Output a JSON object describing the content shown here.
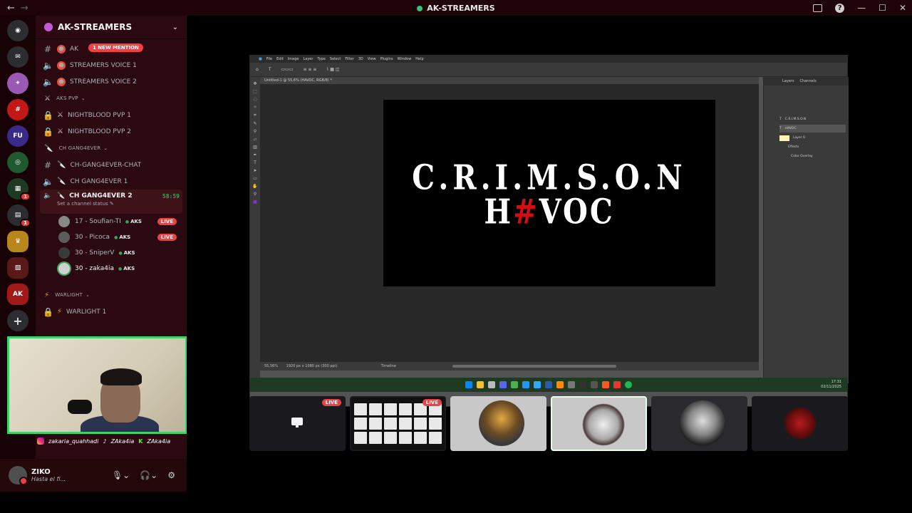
{
  "window": {
    "title": "AK-STREAMERS"
  },
  "server": {
    "name": "AK-STREAMERS",
    "mention_badge": "1 NEW MENTION",
    "rail_badges": [
      "1",
      "1"
    ]
  },
  "channels": {
    "top": [
      {
        "name": "AK",
        "icon": "#"
      },
      {
        "name": "STREAMERS VOICE 1",
        "icon": "voice"
      },
      {
        "name": "STREAMERS VOICE 2",
        "icon": "voice"
      }
    ],
    "cat_aks_pvp": "AKS PVP",
    "aks_pvp": [
      {
        "name": "NIGHTBLOOD PVP 1"
      },
      {
        "name": "NIGHTBLOOD PVP 2"
      }
    ],
    "cat_gang": "CH GANG4EVER",
    "gang": [
      {
        "name": "CH-GANG4EVER-CHAT"
      },
      {
        "name": "CH GANG4EVER 1"
      }
    ],
    "active": {
      "name": "CH GANG4EVER 2",
      "timer": "58:59",
      "status": "Set a channel status"
    },
    "voice_users": [
      {
        "name": "17 - Soufian-TI",
        "tag": "AKS",
        "live": "LIVE"
      },
      {
        "name": "30 - Picoca",
        "tag": "AKS",
        "live": "LIVE"
      },
      {
        "name": "30 - SniperV",
        "tag": "AKS"
      },
      {
        "name": "30 - zaka4ia",
        "tag": "AKS"
      }
    ],
    "cat_warlight": "WARLIGHT",
    "warlight": [
      {
        "name": "WARLIGHT 1"
      }
    ]
  },
  "webcam": {
    "social_ig": "zakaria_quahhadi",
    "social_tt": "ZAka4ia",
    "social_kick": "ZAka4ia"
  },
  "user": {
    "name": "ZIKO",
    "status": "Hasta el fi..."
  },
  "photoshop": {
    "menu": [
      "File",
      "Edit",
      "Image",
      "Layer",
      "Type",
      "Select",
      "Filter",
      "3D",
      "View",
      "Plugins",
      "Window",
      "Help"
    ],
    "doc_tab": "Untitled-1 @ 55,6% (HAVOC, RGB/8) *",
    "zoom": "55,56%",
    "doc_info": "1920 px x 1080 px (300 ppi)",
    "timeline": "Timeline",
    "panel_tabs": [
      "Layers",
      "Channels"
    ],
    "layers": [
      "C.R.I.M.S.O.N",
      "HAVOC",
      "Layer 0",
      "Effects",
      "Color Overlay"
    ],
    "logo_line1": "C.R.I.M.S.O.N",
    "logo_line2_a": "H",
    "logo_line2_hash": "#",
    "logo_line2_b": "VOC",
    "clock_time": "17:31",
    "clock_date": "02/11/2025"
  },
  "tiles": [
    {
      "kind": "screen",
      "live": "LIVE"
    },
    {
      "kind": "grid",
      "live": "LIVE"
    },
    {
      "kind": "avatar"
    },
    {
      "kind": "avatar-selected"
    },
    {
      "kind": "avatar"
    },
    {
      "kind": "avatar"
    }
  ],
  "colors": {
    "accent_green": "#3ba55d",
    "live_red": "#ed4245",
    "sidebar_bg": "#2a0a10",
    "logo_red": "#d01010"
  }
}
